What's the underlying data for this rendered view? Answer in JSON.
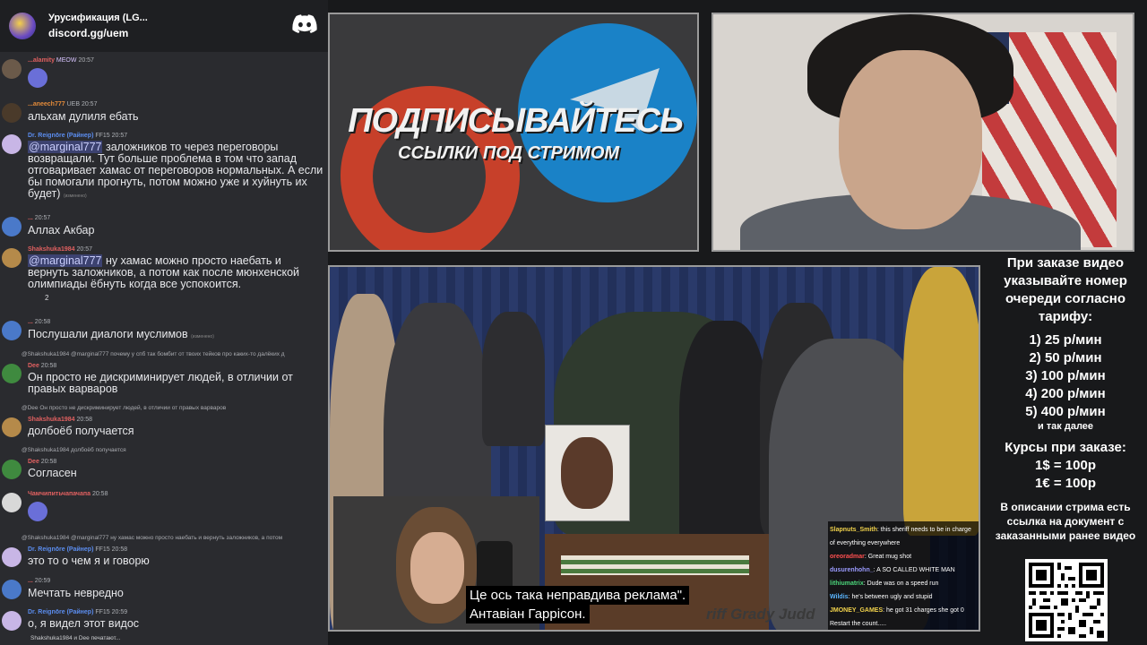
{
  "server": {
    "name": "Урусификация (LG...",
    "link": "discord.gg/uem"
  },
  "messages": [
    {
      "user": "...alamity",
      "badge": "MEOW",
      "time": "20:57",
      "text": "",
      "color": "#e06060"
    },
    {
      "user": "...aneech777",
      "badge": "UEB",
      "time": "20:57",
      "text": "альхам дулиля ебать",
      "color": "#e28a3a"
    },
    {
      "user": "Dr. Reignōre (Райнер)",
      "badge": "FF15",
      "time": "20:57",
      "mention": "@marginal777",
      "text": "заложников то через переговоры возвращали. Тут больше проблема в том что запад отговаривает хамас от переговоров нормальных. А если бы помогали прогнуть, потом можно уже и хуйнуть их будет)",
      "color": "#5b8def",
      "edited": "(изменено)"
    },
    {
      "user": "...",
      "badge": "",
      "time": "20:57",
      "text": "Аллах Акбар",
      "color": "#e06060"
    },
    {
      "user": "Shakshuka1984",
      "badge": "",
      "time": "20:57",
      "mention": "@marginal777",
      "text": "ну хамас можно просто наебать и вернуть заложников, а потом как после мюнхенской олимпиады ёбнуть когда все успокоится.",
      "color": "#e06060",
      "reactions": "2"
    },
    {
      "user": "...",
      "badge": "",
      "time": "20:58",
      "text": "Послушали диалоги муслимов",
      "color": "#e06060",
      "edited": "(изменено)"
    },
    {
      "reply": "@Shakshuka1984 @marginal777 почему у спб так бомбит от твоих тейков про каких-то далёких д",
      "user": "Dee",
      "badge": "",
      "time": "20:58",
      "text": "Он просто не дискриминирует людей, в отличии от правых варваров",
      "color": "#e06060"
    },
    {
      "reply": "@Dee Он просто не дискриминирует людей, в отличии от правых варваров",
      "user": "Shakshuka1984",
      "badge": "",
      "time": "20:58",
      "text": "долбоёб получается",
      "color": "#e06060"
    },
    {
      "reply": "@Shakshuka1984 долбоёб получается",
      "user": "Dee",
      "badge": "",
      "time": "20:58",
      "text": "Согласен",
      "color": "#e06060"
    },
    {
      "user": "Чамчипитьчапачапа",
      "badge": "",
      "time": "20:58",
      "text": "",
      "color": "#e06060"
    },
    {
      "reply": "@Shakshuka1984 @marginal777 ну хамас можно просто наебать и вернуть заложников, а потом",
      "user": "Dr. Reignōre (Райнер)",
      "badge": "FF15",
      "time": "20:58",
      "text": "это то о чем я и говорю",
      "color": "#5b8def"
    },
    {
      "user": "...",
      "badge": "",
      "time": "20:59",
      "text": "Мечтать невредно",
      "color": "#e06060"
    },
    {
      "user": "Dr. Reignōre (Райнер)",
      "badge": "FF15",
      "time": "20:59",
      "text": "о, я видел этот видос",
      "color": "#5b8def"
    }
  ],
  "typing": "Shakshuka1984 и Dee печатают...",
  "promo": {
    "title": "ПОДПИСЫВАЙТЕСЬ",
    "subtitle": "ССЫЛКИ ПОД СТРИМОМ"
  },
  "video": {
    "podium_label": "riff Grady Judd",
    "subtitle_line1": "Це ось така неправдива реклама\".",
    "subtitle_line2": "Антавіан Гаррісон."
  },
  "overlay_chat": [
    {
      "user": "Slapnuts_Smith",
      "text": "this sheriff needs to be in charge",
      "color": "#f2d34c"
    },
    {
      "user": "",
      "text": "of everything everywhere",
      "color": "#f2d34c"
    },
    {
      "user": "oreoradmar",
      "text": "Great mug shot",
      "color": "#ff5050"
    },
    {
      "user": "dusurenhohn_",
      "text": "A SO CALLED WHITE MAN",
      "color": "#9b9bff"
    },
    {
      "user": "lithiumatrix",
      "text": "Dude was on a speed run",
      "color": "#4cd67b"
    },
    {
      "user": "Wildis",
      "text": "he's between ugly and stupid",
      "color": "#5bb6ff"
    },
    {
      "user": "JMONEY_GAMES",
      "text": "he got 31 charges she got 0",
      "color": "#f2d34c"
    },
    {
      "user": "",
      "text": "Restart the count.....",
      "color": "#f2d34c"
    }
  ],
  "info": {
    "order_text": "При заказе видео указывайте номер очереди согласно тарифу:",
    "tariffs": [
      "1) 25 р/мин",
      "2) 50 р/мин",
      "3) 100 р/мин",
      "4) 200 р/мин",
      "5) 400 р/мин"
    ],
    "etc": "и так далее",
    "courses_title": "Курсы при заказе:",
    "rates": [
      "1$ = 100р",
      "1€ = 100р"
    ],
    "description_text": "В описании стрима есть ссылка на документ с заказанными ранее видео"
  }
}
